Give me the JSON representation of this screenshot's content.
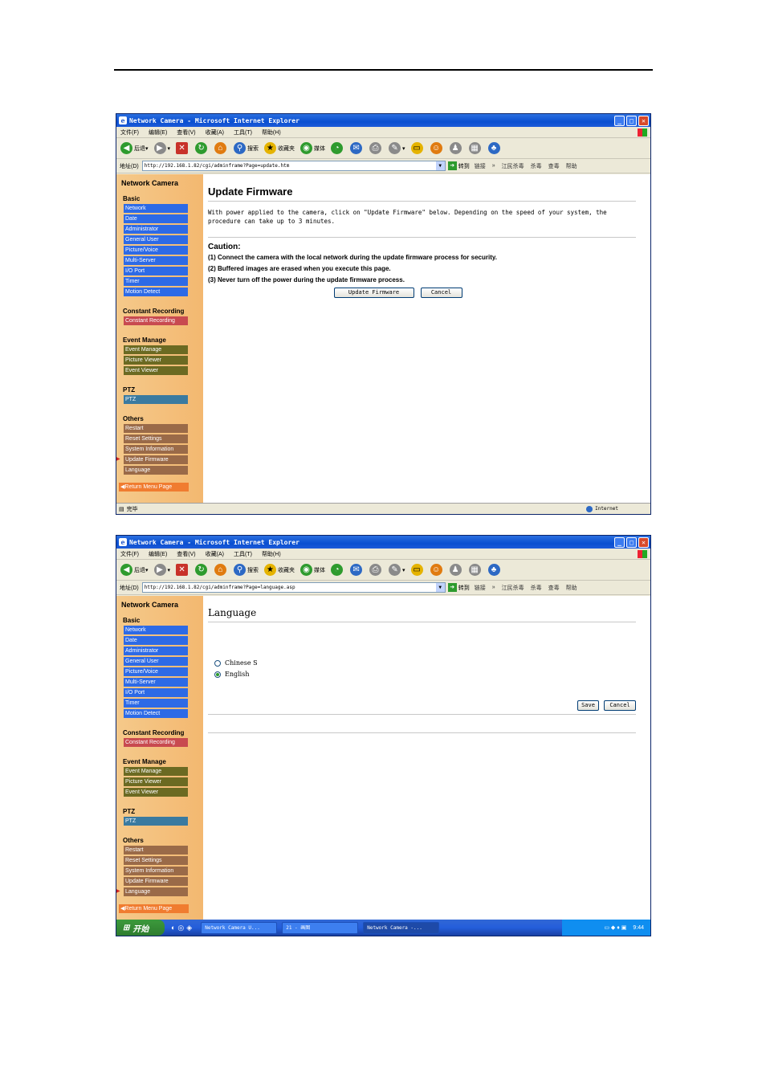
{
  "ie": {
    "title": "Network Camera - Microsoft Internet Explorer",
    "menu": [
      "文件(F)",
      "编辑(E)",
      "查看(V)",
      "收藏(A)",
      "工具(T)",
      "帮助(H)"
    ],
    "toolbar": {
      "back": "后退",
      "search": "搜索",
      "favorites": "收藏夹",
      "media": "媒体"
    },
    "address_label": "地址(D)",
    "go": "转到",
    "links": "链接",
    "ext1": "江民杀毒",
    "ext2": "杀毒",
    "ext3": "查毒",
    "help": "帮助"
  },
  "sidebar": {
    "title": "Network Camera",
    "basic_label": "Basic",
    "basic": [
      "Network",
      "Date",
      "Administrator",
      "General User",
      "Picture/Voice",
      "Multi-Server",
      "I/O Port",
      "Timer",
      "Motion Detect"
    ],
    "rec_label": "Constant Recording",
    "rec": [
      "Constant Recording"
    ],
    "event_label": "Event Manage",
    "event": [
      "Event Manage",
      "Picture Viewer",
      "Event Viewer"
    ],
    "ptz_label": "PTZ",
    "ptz": [
      "PTZ"
    ],
    "others_label": "Others",
    "others": [
      "Restart",
      "Reset Settings",
      "System Information",
      "Update Firmware",
      "Language"
    ],
    "return": "Return Menu Page"
  },
  "win1": {
    "address": "http://192.168.1.82/cgi/adminframe?Page=update.htm",
    "page_title": "Update Firmware",
    "description": "With power applied to the camera, click on \"Update Firmware\" below. Depending on the speed of your system, the procedure can take up to 3 minutes.",
    "caution_title": "Caution:",
    "cautions": [
      "(1)  Connect the camera with the local network during the update firmware process for security.",
      "(2)  Buffered images are erased when you execute this page.",
      "(3)  Never turn off the power during the update firmware process."
    ],
    "update_button": "Update Firmware",
    "cancel_button": "Cancel",
    "status": "完毕",
    "zone": "Internet"
  },
  "win2": {
    "address": "http://192.168.1.82/cgi/adminframe?Page=language.asp",
    "page_title": "Language",
    "options": [
      "Chinese S",
      "English"
    ],
    "selected": "English",
    "save_button": "Save",
    "cancel_button": "Cancel",
    "taskbar": {
      "start": "开始",
      "tasks": [
        "Network Camera U...",
        "21 - 画图",
        "Network Camera -..."
      ],
      "clock": "9:44"
    }
  }
}
